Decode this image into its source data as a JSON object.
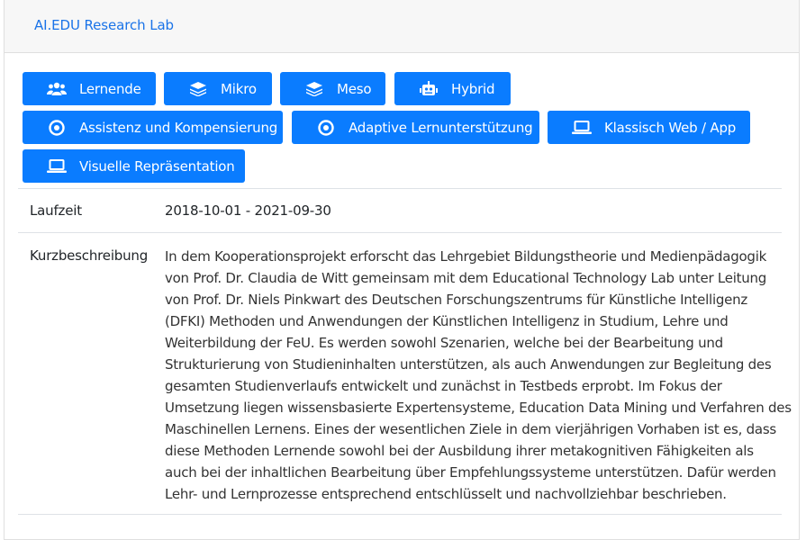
{
  "header": {
    "lab_link": "AI.EDU Research Lab"
  },
  "tags": [
    {
      "label": "Lernende",
      "icon": "users-icon"
    },
    {
      "label": "Mikro",
      "icon": "layers-icon"
    },
    {
      "label": "Meso",
      "icon": "layers-icon"
    },
    {
      "label": "Hybrid",
      "icon": "robot-icon"
    },
    {
      "label": "Assistenz und Kompensierung",
      "icon": "bullseye-icon"
    },
    {
      "label": "Adaptive Lernunterstützung",
      "icon": "bullseye-icon"
    },
    {
      "label": "Klassisch Web / App",
      "icon": "laptop-icon"
    },
    {
      "label": "Visuelle Repräsentation",
      "icon": "laptop-icon"
    }
  ],
  "details": {
    "runtime_label": "Laufzeit",
    "runtime_value": "2018-10-01 - 2021-09-30",
    "summary_label": "Kurzbeschreibung",
    "summary_lines": [
      "In dem Kooperationsprojekt erforscht das Lehrgebiet Bildungstheorie und Medienpädagogik",
      "von Prof. Dr. Claudia de Witt gemeinsam mit dem Educational Technology Lab unter Leitung",
      "von Prof. Dr. Niels Pinkwart des Deutschen Forschungszentrums für Künstliche Intelligenz",
      "(DFKI) Methoden und Anwendungen der Künstlichen Intelligenz in Studium, Lehre und",
      "Weiterbildung der FeU. Es werden sowohl Szenarien, welche bei der Bearbeitung und",
      "Strukturierung von Studieninhalten unterstützen, als auch Anwendungen zur Begleitung des",
      "gesamten Studienverlaufs entwickelt und zunächst in Testbeds erprobt. Im Fokus der",
      "Umsetzung liegen wissensbasierte Expertensysteme, Education Data Mining und Verfahren des",
      "Maschinellen Lernens. Eines der wesentlichen Ziele in dem vierjährigen Vorhaben ist es, dass",
      "diese Methoden Lernende sowohl bei der Ausbildung ihrer metakognitiven Fähigkeiten als",
      "auch bei der inhaltlichen Bearbeitung über Empfehlungssysteme unterstützen. Dafür werden",
      "Lehr- und Lernprozesse entsprechend entschlüsselt und nachvollziehbar beschrieben."
    ]
  },
  "colors": {
    "button": "#0a7cff",
    "link": "#1a73e8"
  }
}
